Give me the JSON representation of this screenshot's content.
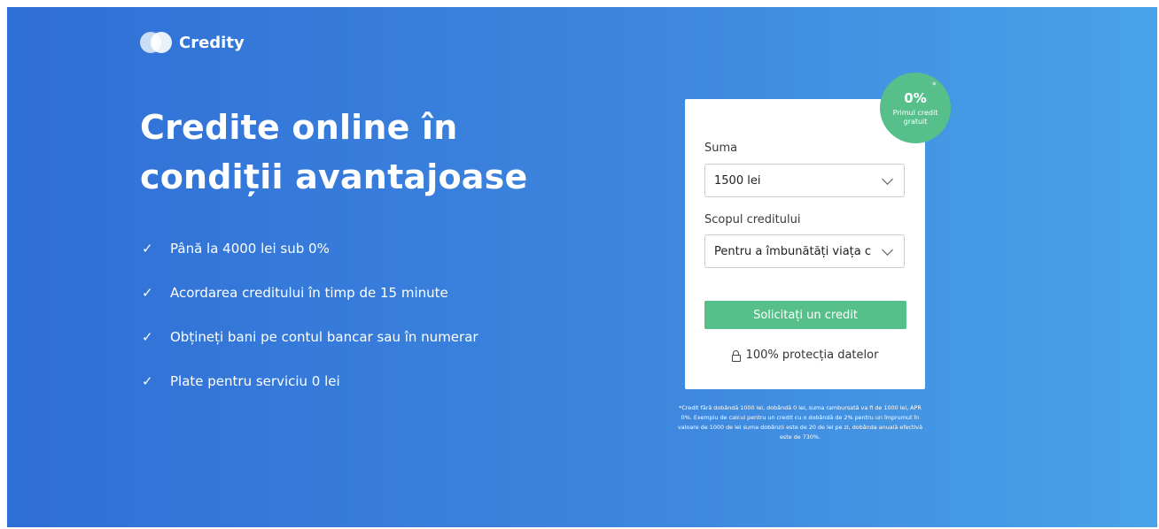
{
  "brand": {
    "name": "Credity"
  },
  "hero": {
    "headline_line1": "Credite online în",
    "headline_line2": "condiții avantajoase",
    "features": [
      "Până la 4000 lei sub 0%",
      "Acordarea creditului în timp de 15 minute",
      "Obțineți bani pe contul bancar sau în numerar",
      "Plate pentru serviciu 0 lei"
    ]
  },
  "badge": {
    "rate": "0%",
    "star": "*",
    "text": "Primul credit gratuit"
  },
  "form": {
    "amount_label": "Suma",
    "amount_value": "1500 lei",
    "purpose_label": "Scopul creditului",
    "purpose_value": "Pentru a îmbunătăți viața c",
    "submit_label": "Solicitați un credit",
    "protection_label": "100% protecția datelor"
  },
  "disclaimer": "*Credit fără dobândă 1000 lei, dobândă 0 lei, suma rambursată va fi de 1000 lei, APR 0%. Exemplu de calcul pentru un credit cu o dobândă de 2% pentru un împrumut în valoare de 1000 de lei suma dobânzii este de 20 de lei pe zi, dobânda anuală efectivă este de 730%.",
  "colors": {
    "gradient_start": "#2f6fd6",
    "gradient_end": "#4aa3e8",
    "accent_green": "#57c08a"
  },
  "icons": {
    "logo": "credity-logo-icon",
    "check": "check-icon",
    "chevron": "chevron-down-icon",
    "lock": "lock-icon"
  }
}
